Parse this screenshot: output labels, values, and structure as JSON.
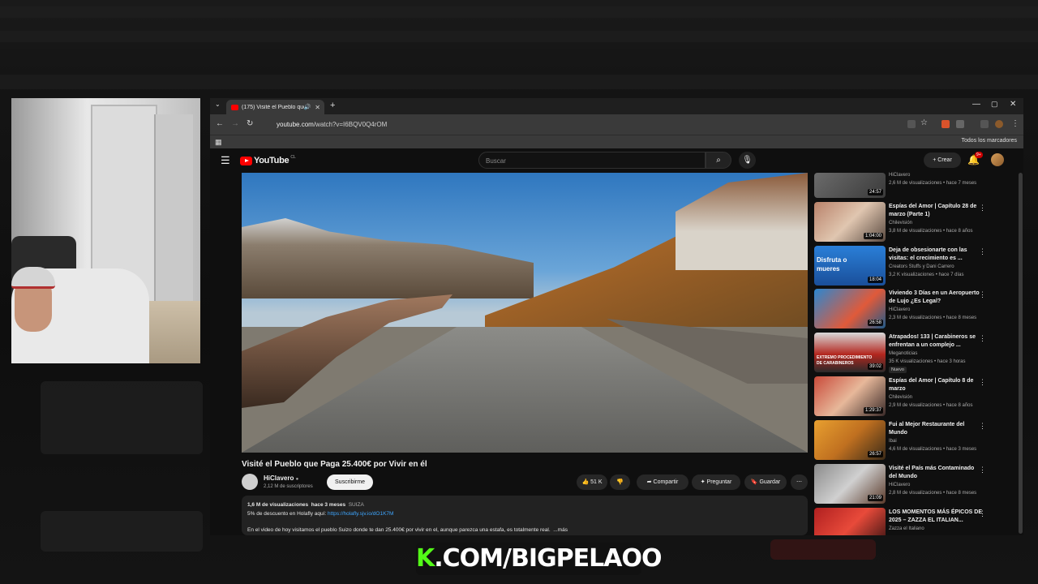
{
  "browser": {
    "tab_title": "(175) Visité el Pueblo que P",
    "url_domain": "youtube.com",
    "url_path": "/watch?v=I6BQV0Q4rOM",
    "bookmarks_label": "Todos los marcadores"
  },
  "youtube": {
    "logo_text": "YouTube",
    "country": "CL",
    "search_placeholder": "Buscar",
    "create_label": "Crear",
    "notif_count": "9+"
  },
  "video": {
    "title": "Visité el Pueblo que Paga 25.400€ por Vivir en él",
    "channel": "HiClavero",
    "subscribers": "2,12 M de suscriptores",
    "subscribe_label": "Suscribirme",
    "likes": "51 K",
    "share_label": "Compartir",
    "ask_label": "Preguntar",
    "save_label": "Guardar",
    "views": "1,6 M de visualizaciones",
    "age": "hace 3 meses",
    "tag": "SUIZA",
    "promo_text": "5% de descuento en Holafly aquí:",
    "promo_link": "https://holafly.sjv.io/dO1K7M",
    "desc_text": "En el video de hoy visitamos el pueblo Suizo donde te dan 25.400€ por vivir en el, aunque parezca una estafa, es totalmente real.",
    "more_label": "...más"
  },
  "recommendations": [
    {
      "title": "",
      "channel": "HiClavero",
      "meta": "2,6 M de visualizaciones • hace 7 meses",
      "duration": "24:57"
    },
    {
      "title": "Espías del Amor | Capítulo 28 de marzo (Parte 1)",
      "channel": "Chilevisión",
      "meta": "3,8 M de visualizaciones • hace 8 años",
      "duration": "1:04:00"
    },
    {
      "title": "Deja de obsesionarte con las visitas: el crecimiento es ...",
      "channel": "Creators Stuffs y Dani Carrero",
      "meta": "3,2 K visualizaciones • hace 7 días",
      "duration": "18:04",
      "overlay": "Disfruta o mueres"
    },
    {
      "title": "Viviendo 3 Días en un Aeropuerto de Lujo ¿Es Legal?",
      "channel": "HiClavero",
      "meta": "2,3 M de visualizaciones • hace 8 meses",
      "duration": "26:58"
    },
    {
      "title": "Atrapados! 133 | Carabineros se enfrentan a un complejo ...",
      "channel": "Meganoticias",
      "meta": "35 K visualizaciones • hace 3 horas",
      "duration": "39:02",
      "badge": "Nuevo",
      "overlay": "EXTREMO PROCEDIMIENTO DE CARABINEROS"
    },
    {
      "title": "Espías del Amor | Capítulo 8 de marzo",
      "channel": "Chilevisión",
      "meta": "2,9 M de visualizaciones • hace 8 años",
      "duration": "1:29:37"
    },
    {
      "title": "Fui al Mejor Restaurante del Mundo",
      "channel": "Ibai",
      "meta": "4,6 M de visualizaciones • hace 3 meses",
      "duration": "26:57"
    },
    {
      "title": "Visité el País más Contaminado del Mundo",
      "channel": "HiClavero",
      "meta": "2,8 M de visualizaciones • hace 8 meses",
      "duration": "21:09"
    },
    {
      "title": "LOS MOMENTOS MÁS ÉPICOS DE 2025 – ZAZZA EL ITALIAN...",
      "channel": "Zazza el Italiano",
      "meta": "",
      "duration": ""
    }
  ],
  "banner": {
    "text": "K.COM/BIGPELAOO"
  },
  "colors": {
    "accent": "#ff0000",
    "kick_green": "#53fc18",
    "link": "#3ea6ff"
  }
}
